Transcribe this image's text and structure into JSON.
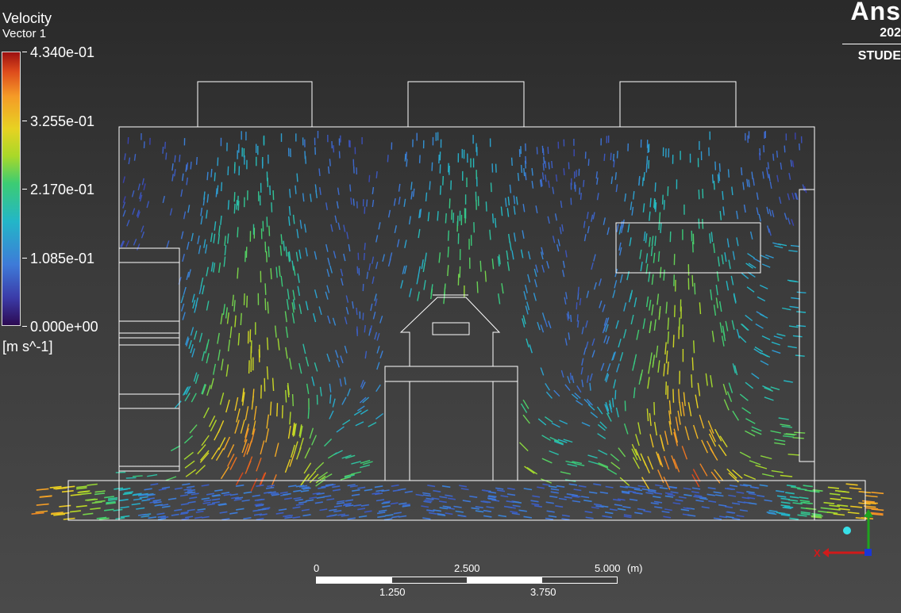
{
  "legend": {
    "title": "Velocity",
    "subtitle": "Vector 1",
    "ticks": [
      "4.340e-01",
      "3.255e-01",
      "2.170e-01",
      "1.085e-01",
      "0.000e+00"
    ],
    "units": "[m s^-1]",
    "colormap": [
      "#2c0a52",
      "#3b3ba8",
      "#3e7ad8",
      "#23b6c8",
      "#3ccc73",
      "#a9d829",
      "#e7d222",
      "#f59a27",
      "#dd4a1c",
      "#9d1010"
    ]
  },
  "logo": {
    "brand": "Ans",
    "year": "202",
    "edition": "STUDE"
  },
  "scale_bar": {
    "top_labels": [
      "0",
      "2.500",
      "5.000"
    ],
    "unit": "(m)",
    "bottom_labels": [
      "1.250",
      "3.750"
    ]
  },
  "triad": {
    "x_label": "X",
    "x_color": "#d11a1a",
    "y_color": "#1fa21f",
    "z_color": "#1a36d6",
    "dot_color": "#38e1e8"
  }
}
